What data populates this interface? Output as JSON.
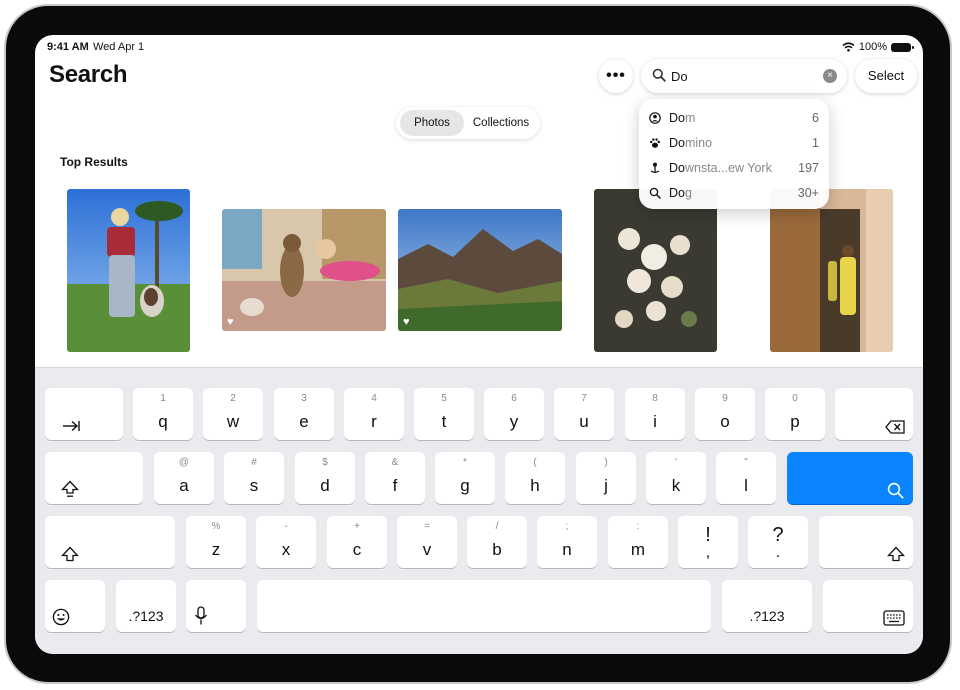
{
  "status": {
    "time": "9:41 AM",
    "date": "Wed Apr 1",
    "battery": "100%"
  },
  "header": {
    "title": "Search",
    "more_label": "•••",
    "select_label": "Select"
  },
  "search": {
    "value": "Do",
    "clear_label": "×"
  },
  "segments": {
    "photos": "Photos",
    "collections": "Collections"
  },
  "section": {
    "top_results": "Top Results"
  },
  "suggestions": [
    {
      "icon": "person-icon",
      "bold": "Do",
      "rest": "m",
      "count": "6"
    },
    {
      "icon": "paw-icon",
      "bold": "Do",
      "rest": "mino",
      "count": "1"
    },
    {
      "icon": "location-pin-icon",
      "bold": "Do",
      "rest": "wnsta...ew York",
      "count": "197"
    },
    {
      "icon": "search-icon",
      "bold": "Do",
      "rest": "g",
      "count": "30+"
    }
  ],
  "keyboard": {
    "row1": [
      {
        "hint": "1",
        "main": "q"
      },
      {
        "hint": "2",
        "main": "w"
      },
      {
        "hint": "3",
        "main": "e"
      },
      {
        "hint": "4",
        "main": "r"
      },
      {
        "hint": "5",
        "main": "t"
      },
      {
        "hint": "6",
        "main": "y"
      },
      {
        "hint": "7",
        "main": "u"
      },
      {
        "hint": "8",
        "main": "i"
      },
      {
        "hint": "9",
        "main": "o"
      },
      {
        "hint": "0",
        "main": "p"
      }
    ],
    "row2": [
      {
        "hint": "@",
        "main": "a"
      },
      {
        "hint": "#",
        "main": "s"
      },
      {
        "hint": "$",
        "main": "d"
      },
      {
        "hint": "&",
        "main": "f"
      },
      {
        "hint": "*",
        "main": "g"
      },
      {
        "hint": "(",
        "main": "h"
      },
      {
        "hint": ")",
        "main": "j"
      },
      {
        "hint": "'",
        "main": "k"
      },
      {
        "hint": "\"",
        "main": "l"
      }
    ],
    "row3": [
      {
        "hint": "%",
        "main": "z"
      },
      {
        "hint": "-",
        "main": "x"
      },
      {
        "hint": "+",
        "main": "c"
      },
      {
        "hint": "=",
        "main": "v"
      },
      {
        "hint": "/",
        "main": "b"
      },
      {
        "hint": ";",
        "main": "n"
      },
      {
        "hint": ":",
        "main": "m"
      }
    ],
    "row3_symbols": [
      {
        "main": "!",
        "sub": ","
      },
      {
        "main": "?",
        "sub": "."
      }
    ],
    "numbers_label": ".?123"
  },
  "colors": {
    "accent": "#0a84ff"
  }
}
